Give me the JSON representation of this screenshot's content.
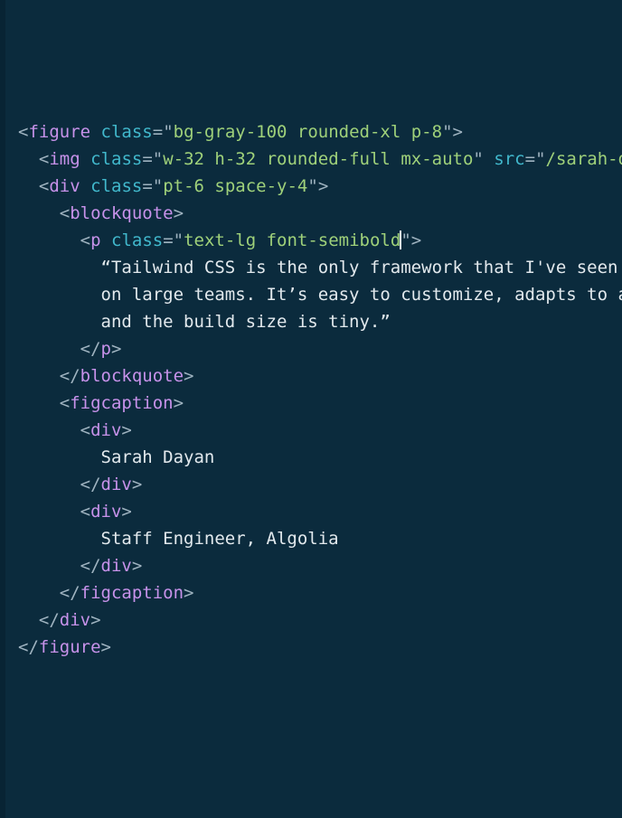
{
  "editor": {
    "background_color": "#0b2b3d",
    "gutter_color": "#082434",
    "plain_text_color": "#e2e9ed",
    "caret_color": "#e8f0f4",
    "font_size_px": 19,
    "line_height_px": 30,
    "language": "html",
    "theme_colors": {
      "tag": "#c792ea",
      "attribute": "#41b8cc",
      "string": "#9fd17a",
      "punctuation": "#9fb3c0",
      "text": "#e2e9ed"
    },
    "caret": {
      "line_index": 4,
      "after_text": "font-semibold",
      "visible": true
    },
    "lines": [
      {
        "indent": 0,
        "tokens": [
          {
            "type": "punct",
            "text": "<"
          },
          {
            "type": "tag",
            "text": "figure"
          },
          {
            "type": "text",
            "text": " "
          },
          {
            "type": "attr",
            "text": "class"
          },
          {
            "type": "punct",
            "text": "=\""
          },
          {
            "type": "string",
            "text": "bg-gray-100 rounded-xl p-8"
          },
          {
            "type": "punct",
            "text": "\">"
          }
        ]
      },
      {
        "indent": 1,
        "tokens": [
          {
            "type": "punct",
            "text": "<"
          },
          {
            "type": "tag",
            "text": "img"
          },
          {
            "type": "text",
            "text": " "
          },
          {
            "type": "attr",
            "text": "class"
          },
          {
            "type": "punct",
            "text": "=\""
          },
          {
            "type": "string",
            "text": "w-32 h-32 rounded-full mx-auto"
          },
          {
            "type": "punct",
            "text": "\""
          },
          {
            "type": "text",
            "text": " "
          },
          {
            "type": "attr",
            "text": "src"
          },
          {
            "type": "punct",
            "text": "=\""
          },
          {
            "type": "string",
            "text": "/sarah-dayan.jpg"
          },
          {
            "type": "punct",
            "text": "\">"
          }
        ]
      },
      {
        "indent": 1,
        "tokens": [
          {
            "type": "punct",
            "text": "<"
          },
          {
            "type": "tag",
            "text": "div"
          },
          {
            "type": "text",
            "text": " "
          },
          {
            "type": "attr",
            "text": "class"
          },
          {
            "type": "punct",
            "text": "=\""
          },
          {
            "type": "string",
            "text": "pt-6 space-y-4"
          },
          {
            "type": "punct",
            "text": "\">"
          }
        ]
      },
      {
        "indent": 2,
        "tokens": [
          {
            "type": "punct",
            "text": "<"
          },
          {
            "type": "tag",
            "text": "blockquote"
          },
          {
            "type": "punct",
            "text": ">"
          }
        ]
      },
      {
        "indent": 3,
        "tokens": [
          {
            "type": "punct",
            "text": "<"
          },
          {
            "type": "tag",
            "text": "p"
          },
          {
            "type": "text",
            "text": " "
          },
          {
            "type": "attr",
            "text": "class"
          },
          {
            "type": "punct",
            "text": "=\""
          },
          {
            "type": "string",
            "text": "text-lg font-semibold"
          },
          {
            "type": "caret",
            "text": ""
          },
          {
            "type": "punct",
            "text": "\">"
          }
        ]
      },
      {
        "indent": 4,
        "tokens": [
          {
            "type": "text",
            "text": "“Tailwind CSS is the only framework that I've seen scale"
          }
        ]
      },
      {
        "indent": 4,
        "tokens": [
          {
            "type": "text",
            "text": "on large teams. It’s easy to customize, adapts to any design,"
          }
        ]
      },
      {
        "indent": 4,
        "tokens": [
          {
            "type": "text",
            "text": "and the build size is tiny.”"
          }
        ]
      },
      {
        "indent": 3,
        "tokens": [
          {
            "type": "punct",
            "text": "</"
          },
          {
            "type": "tag",
            "text": "p"
          },
          {
            "type": "punct",
            "text": ">"
          }
        ]
      },
      {
        "indent": 2,
        "tokens": [
          {
            "type": "punct",
            "text": "</"
          },
          {
            "type": "tag",
            "text": "blockquote"
          },
          {
            "type": "punct",
            "text": ">"
          }
        ]
      },
      {
        "indent": 2,
        "tokens": [
          {
            "type": "punct",
            "text": "<"
          },
          {
            "type": "tag",
            "text": "figcaption"
          },
          {
            "type": "punct",
            "text": ">"
          }
        ]
      },
      {
        "indent": 3,
        "tokens": [
          {
            "type": "punct",
            "text": "<"
          },
          {
            "type": "tag",
            "text": "div"
          },
          {
            "type": "punct",
            "text": ">"
          }
        ]
      },
      {
        "indent": 4,
        "tokens": [
          {
            "type": "text",
            "text": "Sarah Dayan"
          }
        ]
      },
      {
        "indent": 3,
        "tokens": [
          {
            "type": "punct",
            "text": "</"
          },
          {
            "type": "tag",
            "text": "div"
          },
          {
            "type": "punct",
            "text": ">"
          }
        ]
      },
      {
        "indent": 3,
        "tokens": [
          {
            "type": "punct",
            "text": "<"
          },
          {
            "type": "tag",
            "text": "div"
          },
          {
            "type": "punct",
            "text": ">"
          }
        ]
      },
      {
        "indent": 4,
        "tokens": [
          {
            "type": "text",
            "text": "Staff Engineer, Algolia"
          }
        ]
      },
      {
        "indent": 3,
        "tokens": [
          {
            "type": "punct",
            "text": "</"
          },
          {
            "type": "tag",
            "text": "div"
          },
          {
            "type": "punct",
            "text": ">"
          }
        ]
      },
      {
        "indent": 2,
        "tokens": [
          {
            "type": "punct",
            "text": "</"
          },
          {
            "type": "tag",
            "text": "figcaption"
          },
          {
            "type": "punct",
            "text": ">"
          }
        ]
      },
      {
        "indent": 1,
        "tokens": [
          {
            "type": "punct",
            "text": "</"
          },
          {
            "type": "tag",
            "text": "div"
          },
          {
            "type": "punct",
            "text": ">"
          }
        ]
      },
      {
        "indent": 0,
        "tokens": [
          {
            "type": "punct",
            "text": "</"
          },
          {
            "type": "tag",
            "text": "figure"
          },
          {
            "type": "punct",
            "text": ">"
          }
        ]
      }
    ]
  }
}
